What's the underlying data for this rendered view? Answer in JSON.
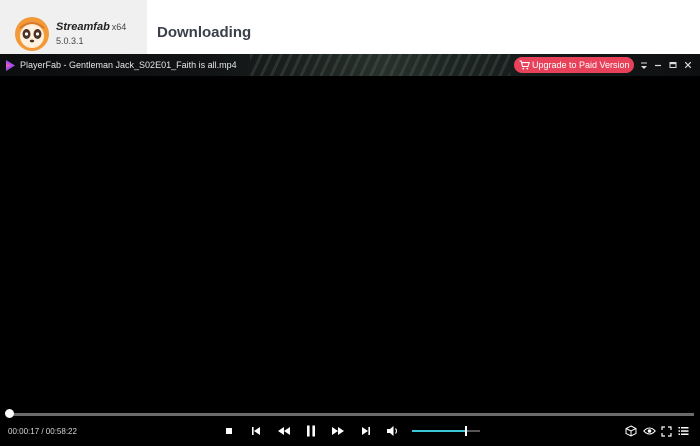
{
  "app": {
    "brand_name": "Streamfab",
    "arch": "x64",
    "version": "5.0.3.1",
    "page_title": "Downloading"
  },
  "player": {
    "title": "PlayerFab - Gentleman Jack_S02E01_Faith is all.mp4",
    "upgrade_label": "Upgrade to Paid Version",
    "time_readout": "00:00:17 / 00:58:22",
    "progress_fraction": 0.005,
    "volume_fraction": 0.8
  },
  "icons": {
    "window_controls": [
      "dropdown-icon",
      "minimize-icon",
      "restore-icon",
      "close-icon"
    ],
    "transport": [
      "stop-icon",
      "previous-icon",
      "rewind-icon",
      "pause-icon",
      "fast-forward-icon",
      "next-icon",
      "volume-icon"
    ],
    "right_tools": [
      "3d-cube-icon",
      "eye-icon",
      "fullscreen-icon",
      "playlist-icon"
    ]
  },
  "colors": {
    "upgrade_button": "#e8425a",
    "volume_fill": "#39c6d6",
    "player_background": "#000000",
    "header_background": "#ffffff",
    "logo_panel_background": "#f0f0f0"
  }
}
